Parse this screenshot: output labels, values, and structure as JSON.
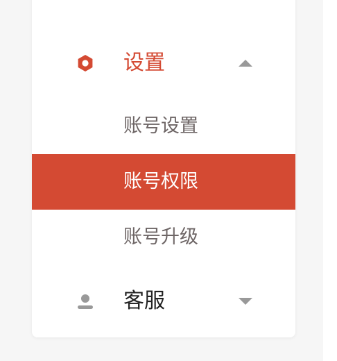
{
  "colors": {
    "accent": "#d44a33",
    "text_dark": "#222222",
    "text_muted": "#6e6666",
    "icon_gray": "#999999",
    "background": "#f6f6f6"
  },
  "menu": {
    "clipped_item_label": "升级",
    "groups": [
      {
        "label": "设置",
        "icon": "hexagon-settings-icon",
        "expanded": true,
        "children": [
          {
            "label": "账号设置",
            "active": false
          },
          {
            "label": "账号权限",
            "active": true
          },
          {
            "label": "账号升级",
            "active": false
          }
        ]
      },
      {
        "label": "客服",
        "icon": "user-icon",
        "expanded": false,
        "children": []
      }
    ]
  }
}
